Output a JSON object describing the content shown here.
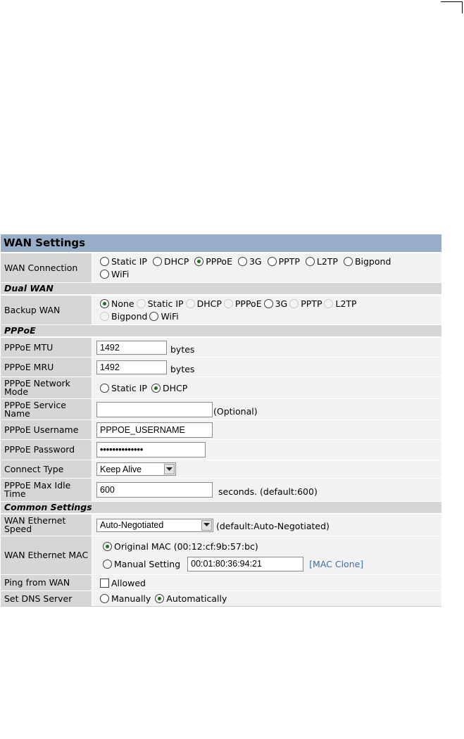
{
  "panel_title": "WAN Settings",
  "rows": {
    "wan_connection": {
      "label": "WAN Connection",
      "options": [
        "Static IP",
        "DHCP",
        "PPPoE",
        "3G",
        "PPTP",
        "L2TP",
        "Bigpond",
        "WiFi"
      ],
      "selected": "PPPoE"
    },
    "dual_wan_section": "Dual WAN",
    "backup_wan": {
      "label": "Backup WAN",
      "options": [
        "None",
        "Static IP",
        "DHCP",
        "PPPoE",
        "3G",
        "PPTP",
        "L2TP",
        "Bigpond",
        "WiFi"
      ],
      "selected": "None"
    },
    "pppoe_section": "PPPoE",
    "pppoe_mtu": {
      "label": "PPPoE MTU",
      "value": "1492",
      "unit": "bytes"
    },
    "pppoe_mru": {
      "label": "PPPoE MRU",
      "value": "1492",
      "unit": "bytes"
    },
    "pppoe_network_mode": {
      "label": "PPPoE Network Mode",
      "options": [
        "Static IP",
        "DHCP"
      ],
      "selected": "DHCP"
    },
    "pppoe_service_name": {
      "label": "PPPoE Service Name",
      "value": "",
      "hint": "(Optional)"
    },
    "pppoe_username": {
      "label": "PPPoE Username",
      "value": "PPPOE_USERNAME"
    },
    "pppoe_password": {
      "label": "PPPoE Password",
      "value": "••••••••••••••"
    },
    "connect_type": {
      "label": "Connect Type",
      "value": "Keep Alive"
    },
    "pppoe_max_idle": {
      "label": "PPPoE Max Idle Time",
      "value": "600",
      "hint": "seconds. (default:600)"
    },
    "common_section": "Common Settings",
    "wan_ethernet_speed": {
      "label": "WAN Ethernet Speed",
      "value": "Auto-Negotiated",
      "hint": "(default:Auto-Negotiated)"
    },
    "wan_ethernet_mac": {
      "label": "WAN Ethernet MAC",
      "original": "Original MAC (00:12:cf:9b:57:bc)",
      "manual": "Manual Setting",
      "manual_value": "00:01:80:36:94:21",
      "clone_link": "[MAC Clone]",
      "selected": "original"
    },
    "ping_from_wan": {
      "label": "Ping from WAN",
      "option": "Allowed",
      "checked": false
    },
    "set_dns_server": {
      "label": "Set DNS Server",
      "options": [
        "Manually",
        "Automatically"
      ],
      "selected": "Automatically"
    }
  },
  "colors": {
    "header_bg": "#98aec8",
    "label_bg": "#d6d6d6",
    "value_bg": "#f2f2f2",
    "link": "#3c6ea8"
  },
  "icons": {
    "radio": "radio-button",
    "checkbox": "checkbox",
    "select_arrow": "chevron-down-icon"
  }
}
